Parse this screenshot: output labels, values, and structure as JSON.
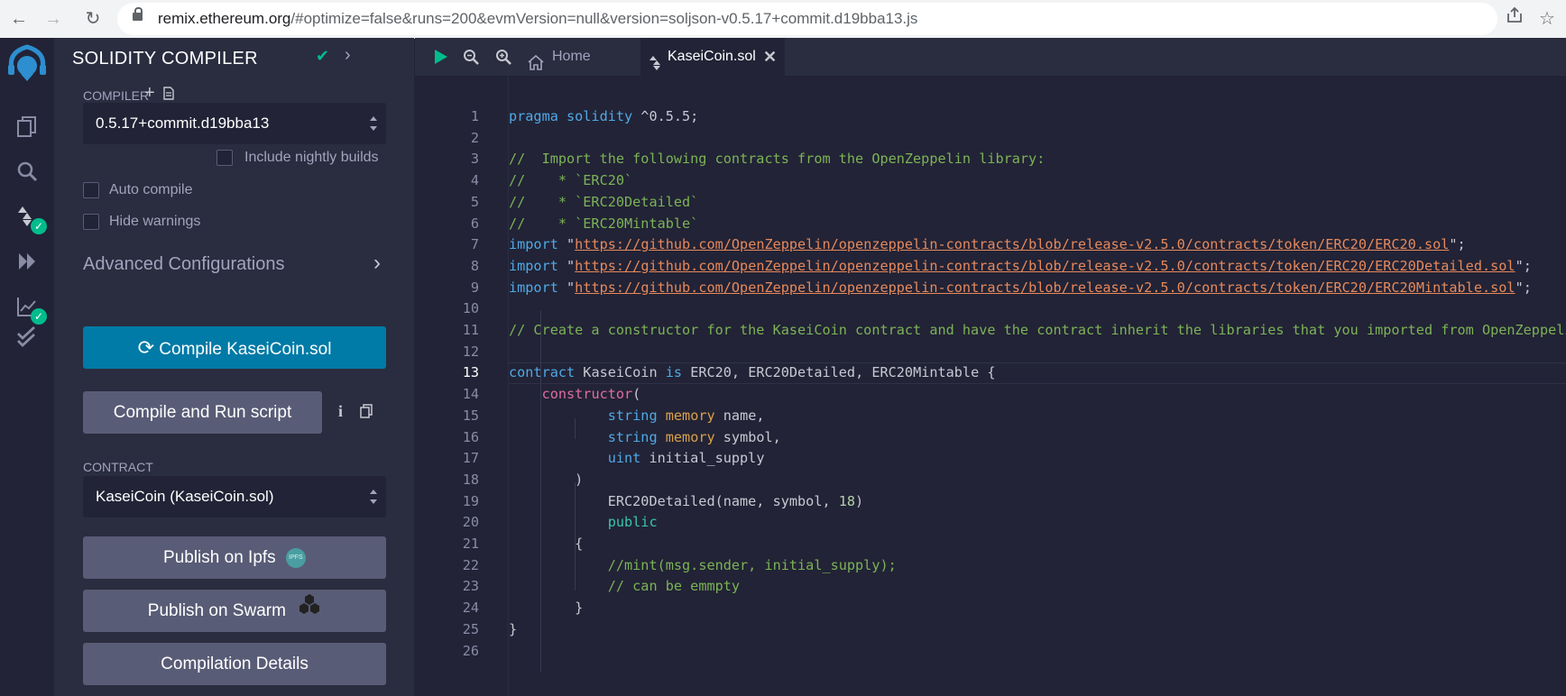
{
  "browser": {
    "url_host": "remix.ethereum.org",
    "url_rest": "/#optimize=false&runs=200&evmVersion=null&version=soljson-v0.5.17+commit.d19bba13.js"
  },
  "panel": {
    "title": "SOLIDITY COMPILER",
    "compiler_label": "COMPILER",
    "compiler_version": "0.5.17+commit.d19bba13",
    "include_nightly": "Include nightly builds",
    "auto_compile": "Auto compile",
    "hide_warnings": "Hide warnings",
    "advanced": "Advanced Configurations",
    "compile_button": "Compile KaseiCoin.sol",
    "compile_run_button": "Compile and Run script",
    "contract_label": "CONTRACT",
    "contract_value": "KaseiCoin (KaseiCoin.sol)",
    "publish_ipfs": "Publish on Ipfs",
    "ipfs_badge": "IPFS",
    "publish_swarm": "Publish on Swarm",
    "compilation_details": "Compilation Details"
  },
  "editor": {
    "tab_home": "Home",
    "tab_file": "KaseiCoin.sol",
    "current_line": 13,
    "lines": [
      [
        [
          "k",
          "pragma solidity"
        ],
        [
          "d",
          " ^0.5.5;"
        ]
      ],
      [],
      [
        [
          "c",
          "//  Import the following contracts from the OpenZeppelin library:"
        ]
      ],
      [
        [
          "c",
          "//    * `ERC20`"
        ]
      ],
      [
        [
          "c",
          "//    * `ERC20Detailed`"
        ]
      ],
      [
        [
          "c",
          "//    * `ERC20Mintable`"
        ]
      ],
      [
        [
          "k",
          "import"
        ],
        [
          "d",
          " \""
        ],
        [
          "s",
          "https://github.com/OpenZeppelin/openzeppelin-contracts/blob/release-v2.5.0/contracts/token/ERC20/ERC20.sol"
        ],
        [
          "d",
          "\";"
        ]
      ],
      [
        [
          "k",
          "import"
        ],
        [
          "d",
          " \""
        ],
        [
          "s",
          "https://github.com/OpenZeppelin/openzeppelin-contracts/blob/release-v2.5.0/contracts/token/ERC20/ERC20Detailed.sol"
        ],
        [
          "d",
          "\";"
        ]
      ],
      [
        [
          "k",
          "import"
        ],
        [
          "d",
          " \""
        ],
        [
          "s",
          "https://github.com/OpenZeppelin/openzeppelin-contracts/blob/release-v2.5.0/contracts/token/ERC20/ERC20Mintable.sol"
        ],
        [
          "d",
          "\";"
        ]
      ],
      [],
      [
        [
          "c",
          "// Create a constructor for the KaseiCoin contract and have the contract inherit the libraries that you imported from OpenZeppelin."
        ]
      ],
      [],
      [
        [
          "k",
          "contract"
        ],
        [
          "d",
          " KaseiCoin "
        ],
        [
          "k",
          "is"
        ],
        [
          "d",
          " ERC20, ERC20Detailed, ERC20Mintable {"
        ]
      ],
      [
        [
          "d",
          "    "
        ],
        [
          "p",
          "constructor"
        ],
        [
          "d",
          "("
        ]
      ],
      [
        [
          "d",
          "            "
        ],
        [
          "t",
          "string"
        ],
        [
          "d",
          " "
        ],
        [
          "m",
          "memory"
        ],
        [
          "d",
          " name,"
        ]
      ],
      [
        [
          "d",
          "            "
        ],
        [
          "t",
          "string"
        ],
        [
          "d",
          " "
        ],
        [
          "m",
          "memory"
        ],
        [
          "d",
          " symbol,"
        ]
      ],
      [
        [
          "d",
          "            "
        ],
        [
          "t",
          "uint"
        ],
        [
          "d",
          " initial_supply"
        ]
      ],
      [
        [
          "d",
          "        )"
        ]
      ],
      [
        [
          "d",
          "            ERC20Detailed(name, symbol, "
        ],
        [
          "n",
          "18"
        ],
        [
          "d",
          ")"
        ]
      ],
      [
        [
          "d",
          "            "
        ],
        [
          "pub",
          "public"
        ]
      ],
      [
        [
          "d",
          "        {"
        ]
      ],
      [
        [
          "d",
          "            "
        ],
        [
          "c",
          "//mint(msg.sender, initial_supply);"
        ]
      ],
      [
        [
          "d",
          "            "
        ],
        [
          "c",
          "// can be emmpty"
        ]
      ],
      [
        [
          "d",
          "        }"
        ]
      ],
      [
        [
          "d",
          "}"
        ]
      ],
      []
    ]
  }
}
